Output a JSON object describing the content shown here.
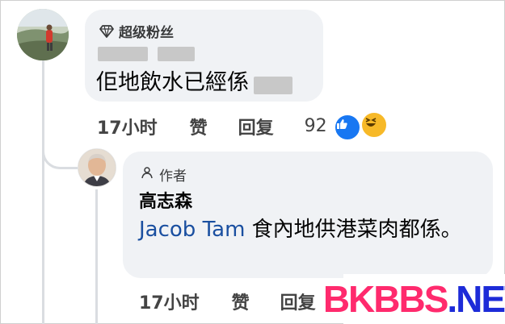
{
  "comment1": {
    "badge": "超级粉丝",
    "text": "佢地飲水已經係",
    "time": "17小时",
    "like_label": "赞",
    "reply_label": "回复",
    "reaction_count": "92"
  },
  "comment2": {
    "author_badge": "作者",
    "name": "高志森",
    "mention": "Jacob Tam",
    "text": " 食內地供港菜肉都係。",
    "time": "17小时",
    "like_label": "赞",
    "reply_label": "回复"
  },
  "watermark": {
    "part1": "BKBBS",
    "part2": ".NET"
  },
  "colors": {
    "bubble": "#f0f2f5",
    "mention": "#1a4fa0",
    "like_reaction": "#1877f2",
    "haha_reaction": "#f7b928",
    "logo_pink": "#ff2a6d",
    "logo_blue": "#1d2bd8"
  }
}
